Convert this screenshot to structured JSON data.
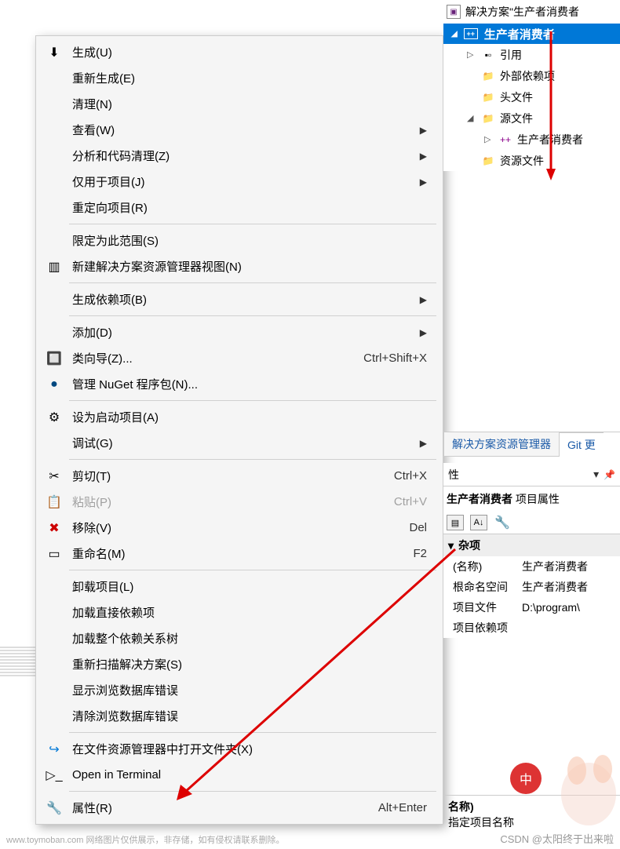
{
  "menu": {
    "items": [
      {
        "icon": "build",
        "label": "生成(U)"
      },
      {
        "icon": "",
        "label": "重新生成(E)"
      },
      {
        "icon": "",
        "label": "清理(N)"
      },
      {
        "icon": "",
        "label": "查看(W)",
        "arrow": true
      },
      {
        "icon": "",
        "label": "分析和代码清理(Z)",
        "arrow": true
      },
      {
        "icon": "",
        "label": "仅用于项目(J)",
        "arrow": true
      },
      {
        "icon": "",
        "label": "重定向项目(R)"
      },
      {
        "sep": true
      },
      {
        "icon": "",
        "label": "限定为此范围(S)"
      },
      {
        "icon": "newview",
        "label": "新建解决方案资源管理器视图(N)"
      },
      {
        "sep": true
      },
      {
        "icon": "",
        "label": "生成依赖项(B)",
        "arrow": true
      },
      {
        "sep": true
      },
      {
        "icon": "",
        "label": "添加(D)",
        "arrow": true
      },
      {
        "icon": "wizard",
        "label": "类向导(Z)...",
        "shortcut": "Ctrl+Shift+X"
      },
      {
        "icon": "nuget",
        "label": "管理 NuGet 程序包(N)..."
      },
      {
        "sep": true
      },
      {
        "icon": "gear",
        "label": "设为启动项目(A)"
      },
      {
        "icon": "",
        "label": "调试(G)",
        "arrow": true
      },
      {
        "sep": true
      },
      {
        "icon": "cut",
        "label": "剪切(T)",
        "shortcut": "Ctrl+X"
      },
      {
        "icon": "paste",
        "label": "粘贴(P)",
        "shortcut": "Ctrl+V",
        "disabled": true
      },
      {
        "icon": "remove",
        "label": "移除(V)",
        "shortcut": "Del"
      },
      {
        "icon": "rename",
        "label": "重命名(M)",
        "shortcut": "F2"
      },
      {
        "sep": true
      },
      {
        "icon": "",
        "label": "卸载项目(L)"
      },
      {
        "icon": "",
        "label": "加载直接依赖项"
      },
      {
        "icon": "",
        "label": "加载整个依赖关系树"
      },
      {
        "icon": "",
        "label": "重新扫描解决方案(S)"
      },
      {
        "icon": "",
        "label": "显示浏览数据库错误"
      },
      {
        "icon": "",
        "label": "清除浏览数据库错误"
      },
      {
        "sep": true
      },
      {
        "icon": "openfolder",
        "label": "在文件资源管理器中打开文件夹(X)"
      },
      {
        "icon": "terminal",
        "label": "Open in Terminal"
      },
      {
        "sep": true
      },
      {
        "icon": "wrench",
        "label": "属性(R)",
        "shortcut": "Alt+Enter"
      }
    ]
  },
  "solution": {
    "header": "解决方案\"生产者消费者",
    "project": "生产者消费者",
    "tree": [
      {
        "label": "引用",
        "icon": "ref",
        "expand": "▷"
      },
      {
        "label": "外部依赖项",
        "icon": "folder",
        "expand": ""
      },
      {
        "label": "头文件",
        "icon": "folder",
        "expand": ""
      },
      {
        "label": "源文件",
        "icon": "folder",
        "expand": "◢"
      },
      {
        "label": "生产者消费者",
        "icon": "cpp",
        "expand": "▷",
        "level": 2
      },
      {
        "label": "资源文件",
        "icon": "folder",
        "expand": ""
      }
    ]
  },
  "tabs": {
    "active": "解决方案资源管理器",
    "inactive": "Git 更"
  },
  "propsHeader": {
    "title": "性",
    "dash": "▾"
  },
  "props": {
    "title_bold": "生产者消费者",
    "title_rest": " 项目属性",
    "group": "杂项",
    "rows": [
      {
        "key": "(名称)",
        "val": "生产者消费者"
      },
      {
        "key": "根命名空间",
        "val": "生产者消费者"
      },
      {
        "key": "项目文件",
        "val": "D:\\program\\"
      },
      {
        "key": "项目依赖项",
        "val": ""
      }
    ]
  },
  "propsDesc": {
    "name": "名称)",
    "sub": "指定项目名称"
  },
  "watermark": {
    "left": "www.toymoban.com 网络图片仅供展示，非存储，如有侵权请联系删除。",
    "right": "CSDN @太阳终于出来啦"
  },
  "lantern": "中"
}
